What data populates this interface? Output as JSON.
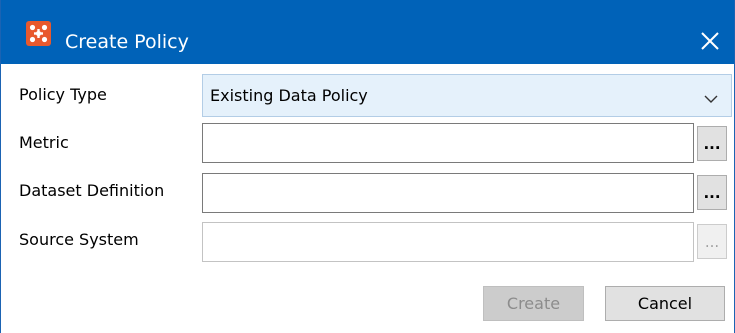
{
  "window": {
    "title": "Create Policy",
    "app_icon": "pink-dots-logo-icon",
    "close_icon": "close-x-icon",
    "titlebar_color": "#0062b8"
  },
  "form": {
    "policy_type": {
      "label": "Policy Type",
      "value": "Existing Data Policy",
      "chevron_icon": "chevron-down-icon"
    },
    "metric": {
      "label": "Metric",
      "value": "",
      "browse_label": "..."
    },
    "dataset_definition": {
      "label": "Dataset Definition",
      "value": "",
      "browse_label": "..."
    },
    "source_system": {
      "label": "Source System",
      "value": "",
      "browse_label": "...",
      "disabled": true
    }
  },
  "actions": {
    "create_label": "Create",
    "create_disabled": true,
    "cancel_label": "Cancel"
  }
}
